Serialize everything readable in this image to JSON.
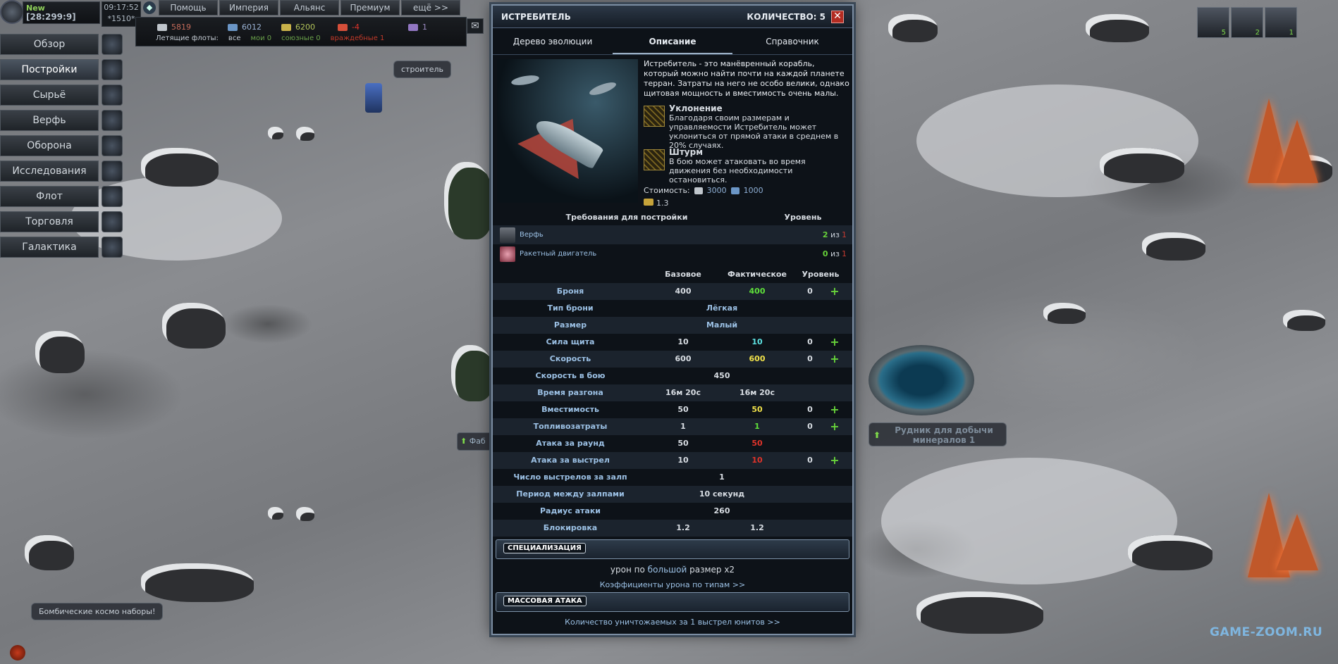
{
  "player": {
    "status": "New",
    "coords": "[28:299:9]"
  },
  "clock": {
    "time": "09:17:52",
    "temp": "*1510*"
  },
  "top_menu": [
    "Помощь",
    "Империя",
    "Альянс",
    "Премиум",
    "ещё >>"
  ],
  "resources": {
    "metal": "5819",
    "crystal": "6012",
    "deuterium": "6200",
    "energy": "-4",
    "dark_matter": "1"
  },
  "flights": {
    "label": "Летящие флоты:",
    "all": "все",
    "mine": "мои 0",
    "allied": "союзные 0",
    "hostile": "враждебные 1"
  },
  "left_nav": [
    "Обзор",
    "Постройки",
    "Сырьё",
    "Верфь",
    "Оборона",
    "Исследования",
    "Флот",
    "Торговля",
    "Галактика"
  ],
  "map": {
    "builder_bubble": "строитель",
    "mine_label": "Рудник для добычи минералов 1",
    "left_label": "Фаб",
    "promo": "Бомбические космо наборы!",
    "watermark": "GAME-ZOOM.RU",
    "fleet_counts": [
      "5",
      "2",
      "1"
    ]
  },
  "panel": {
    "title": "ИСТРЕБИТЕЛЬ",
    "quantity": "КОЛИЧЕСТВО: 5",
    "close": "✕",
    "tabs": [
      "Дерево эволюции",
      "Описание",
      "Справочник"
    ],
    "description": "Истребитель - это манёвренный корабль, который можно найти почти на каждой планете терран. Затраты на него не особо велики, однако щитовая мощность и вместимость очень малы.",
    "abilities": [
      {
        "name": "Уклонение",
        "text": "Благодаря своим размерам и управляемости Истребитель может уклониться от прямой атаки в среднем в 20% случаях."
      },
      {
        "name": "Штурм",
        "text": "В бою может атаковать во время движения без необходимости остановиться."
      }
    ],
    "cost_label": "Стоимость:",
    "cost_metal": "3000",
    "cost_crystal": "1000",
    "rating": "1.3",
    "req_header": "Требования для постройки",
    "level_header": "Уровень",
    "requirements": [
      {
        "name": "Верфь",
        "have": "2",
        "of": "из",
        "need": "1"
      },
      {
        "name": "Ракетный двигатель",
        "have": "0",
        "of": "из",
        "need": "1"
      }
    ],
    "stats_header": {
      "base": "Базовое",
      "actual": "Фактическое",
      "level": "Уровень"
    },
    "stats": [
      {
        "name": "Броня",
        "base": "400",
        "actual": "400",
        "level": "0",
        "plus": "+",
        "color": "g"
      },
      {
        "name": "Тип брони",
        "merged": "Лёгкая"
      },
      {
        "name": "Размер",
        "merged": "Малый"
      },
      {
        "name": "Сила щита",
        "base": "10",
        "actual": "10",
        "level": "0",
        "plus": "+",
        "color": "cy"
      },
      {
        "name": "Скорость",
        "base": "600",
        "actual": "600",
        "level": "0",
        "plus": "+",
        "color": "y"
      },
      {
        "name": "Скорость в бою",
        "single": "450"
      },
      {
        "name": "Время разгона",
        "base": "16м 20с",
        "actual": "16м 20с",
        "color": ""
      },
      {
        "name": "Вместимость",
        "base": "50",
        "actual": "50",
        "level": "0",
        "plus": "+",
        "color": "y"
      },
      {
        "name": "Топливозатраты",
        "base": "1",
        "actual": "1",
        "level": "0",
        "plus": "+",
        "color": "g"
      },
      {
        "name": "Атака за раунд",
        "base": "50",
        "actual": "50",
        "color": "r"
      },
      {
        "name": "Атака за выстрел",
        "base": "10",
        "actual": "10",
        "level": "0",
        "plus": "+",
        "color": "r"
      },
      {
        "name": "Число выстрелов за залп",
        "single": "1"
      },
      {
        "name": "Период между залпами",
        "single": "10 секунд"
      },
      {
        "name": "Радиус атаки",
        "single": "260"
      },
      {
        "name": "Блокировка",
        "base": "1.2",
        "actual": "1.2",
        "color": ""
      }
    ],
    "spec_label": "СПЕЦИАЛИЗАЦИЯ",
    "spec_text_a": "урон по",
    "spec_text_link": "большой",
    "spec_text_b": "размер x2",
    "spec_link": "Коэффициенты урона по типам >>",
    "mass_label": "МАССОВАЯ АТАКА",
    "mass_link": "Количество уничтожаемых за 1 выстрел юнитов >>"
  },
  "colors": {
    "accent": "#9cc1e5",
    "green": "#5ee03a",
    "red": "#e0332a",
    "yellow": "#f0e14a"
  }
}
